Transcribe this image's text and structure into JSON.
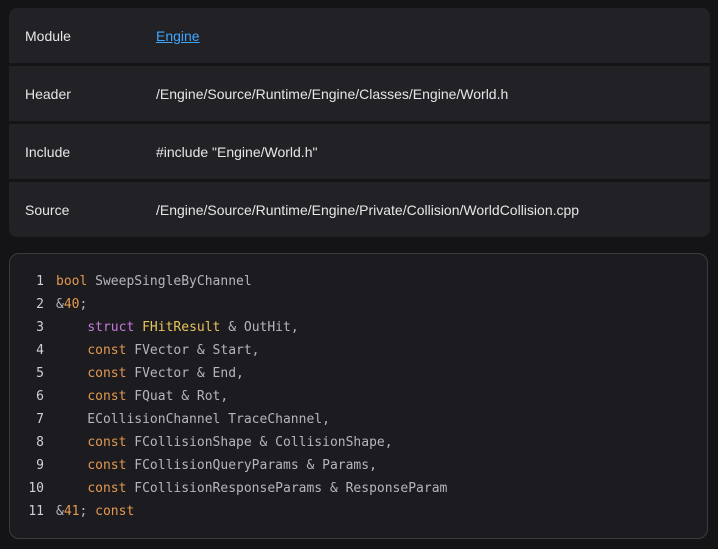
{
  "info": {
    "rows": [
      {
        "label": "Module",
        "value": "Engine",
        "is_link": true
      },
      {
        "label": "Header",
        "value": "/Engine/Source/Runtime/Engine/Classes/Engine/World.h",
        "is_link": false
      },
      {
        "label": "Include",
        "value": "#include \"Engine/World.h\"",
        "is_link": false
      },
      {
        "label": "Source",
        "value": "/Engine/Source/Runtime/Engine/Private/Collision/WorldCollision.cpp",
        "is_link": false
      }
    ]
  },
  "code": {
    "lines": [
      {
        "n": "1",
        "tokens": [
          {
            "t": "bool",
            "c": "kw"
          },
          {
            "t": " SweepSingleByChannel",
            "c": "plain"
          }
        ]
      },
      {
        "n": "2",
        "tokens": [
          {
            "t": "&",
            "c": "plain"
          },
          {
            "t": "40",
            "c": "num"
          },
          {
            "t": ";",
            "c": "plain"
          }
        ]
      },
      {
        "n": "3",
        "tokens": [
          {
            "t": "    ",
            "c": "plain"
          },
          {
            "t": "struct",
            "c": "kw2"
          },
          {
            "t": " ",
            "c": "plain"
          },
          {
            "t": "FHitResult",
            "c": "type"
          },
          {
            "t": " & OutHit,",
            "c": "plain"
          }
        ]
      },
      {
        "n": "4",
        "tokens": [
          {
            "t": "    ",
            "c": "plain"
          },
          {
            "t": "const",
            "c": "kw"
          },
          {
            "t": " FVector & Start,",
            "c": "plain"
          }
        ]
      },
      {
        "n": "5",
        "tokens": [
          {
            "t": "    ",
            "c": "plain"
          },
          {
            "t": "const",
            "c": "kw"
          },
          {
            "t": " FVector & End,",
            "c": "plain"
          }
        ]
      },
      {
        "n": "6",
        "tokens": [
          {
            "t": "    ",
            "c": "plain"
          },
          {
            "t": "const",
            "c": "kw"
          },
          {
            "t": " FQuat & Rot,",
            "c": "plain"
          }
        ]
      },
      {
        "n": "7",
        "tokens": [
          {
            "t": "    ECollisionChannel TraceChannel,",
            "c": "plain"
          }
        ]
      },
      {
        "n": "8",
        "tokens": [
          {
            "t": "    ",
            "c": "plain"
          },
          {
            "t": "const",
            "c": "kw"
          },
          {
            "t": " FCollisionShape & CollisionShape,",
            "c": "plain"
          }
        ]
      },
      {
        "n": "9",
        "tokens": [
          {
            "t": "    ",
            "c": "plain"
          },
          {
            "t": "const",
            "c": "kw"
          },
          {
            "t": " FCollisionQueryParams & Params,",
            "c": "plain"
          }
        ]
      },
      {
        "n": "10",
        "tokens": [
          {
            "t": "    ",
            "c": "plain"
          },
          {
            "t": "const",
            "c": "kw"
          },
          {
            "t": " FCollisionResponseParams & ResponseParam",
            "c": "plain"
          }
        ]
      },
      {
        "n": "11",
        "tokens": [
          {
            "t": "&",
            "c": "plain"
          },
          {
            "t": "41",
            "c": "num"
          },
          {
            "t": "; ",
            "c": "plain"
          },
          {
            "t": "const",
            "c": "kw"
          }
        ]
      }
    ]
  },
  "colors": {
    "link": "#3ea6ff",
    "keyword": "#e3984f",
    "keyword_struct": "#c678dd",
    "type": "#e8c45a",
    "plain": "#b6b6ba"
  }
}
